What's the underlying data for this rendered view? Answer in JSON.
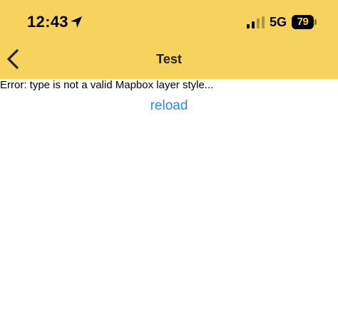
{
  "status_bar": {
    "time": "12:43",
    "location_icon": "location-arrow-icon",
    "signal_icon": "cellular-signal-icon",
    "network": "5G",
    "battery": "79"
  },
  "nav": {
    "back_icon": "chevron-left-icon",
    "title": "Test"
  },
  "content": {
    "error_message": "Error: type is not a valid Mapbox layer style...",
    "reload_label": "reload"
  },
  "colors": {
    "header_background": "#F6D35D",
    "link": "#2F88D8"
  }
}
